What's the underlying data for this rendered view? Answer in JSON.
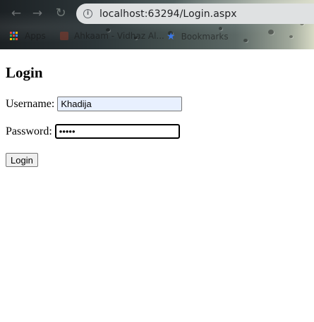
{
  "browser": {
    "url": "localhost:63294/Login.aspx",
    "back_glyph": "←",
    "forward_glyph": "→",
    "reload_glyph": "↻",
    "info_glyph": "i",
    "bookmarks": {
      "apps_label": "Apps",
      "item_label": "Ahkaam - Vidhaz Al...",
      "folder_label": "Bookmarks"
    }
  },
  "page": {
    "title": "Login",
    "username_label": "Username:",
    "username_value": "Khadija",
    "password_label": "Password:",
    "password_value": "•••••",
    "login_button_label": "Login"
  }
}
